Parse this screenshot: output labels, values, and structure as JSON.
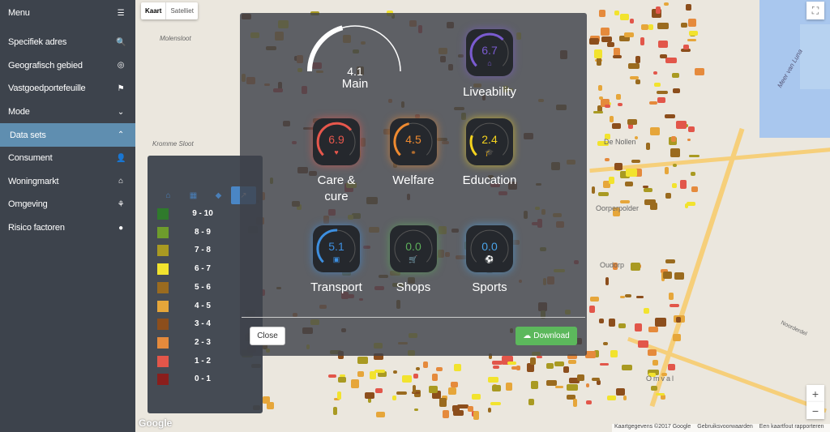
{
  "sidebar": {
    "title": "Menu",
    "items": [
      {
        "label": "Specifiek adres",
        "icon": "search-icon",
        "glyph": "🔍"
      },
      {
        "label": "Geografisch gebied",
        "icon": "target-icon",
        "glyph": "◎"
      },
      {
        "label": "Vastgoedportefeuille",
        "icon": "flag-icon",
        "glyph": "⚑"
      },
      {
        "label": "Mode",
        "icon": "chevron-circle-down-icon",
        "glyph": "⌄"
      },
      {
        "label": "Data sets",
        "icon": "chevron-circle-up-icon",
        "glyph": "⌃",
        "active": true
      },
      {
        "label": "Consument",
        "icon": "user-icon",
        "glyph": "👤"
      },
      {
        "label": "Woningmarkt",
        "icon": "home-icon",
        "glyph": "⌂"
      },
      {
        "label": "Omgeving",
        "icon": "tree-icon",
        "glyph": "⚘"
      },
      {
        "label": "Risico factoren",
        "icon": "bomb-icon",
        "glyph": "●"
      }
    ]
  },
  "map": {
    "type_buttons": [
      "Kaart",
      "Satelliet"
    ],
    "places": [
      "Molensloot",
      "Kromme Sloot",
      "De Nollen",
      "Oorperpolder",
      "Oudorp",
      "Omval",
      "Meer van Luna",
      "Noorderdel"
    ],
    "attribution": [
      "Kaartgegevens ©2017 Google",
      "Gebruiksvoorwaarden",
      "Een kaartfout rapporteren"
    ],
    "logo": "Google",
    "zoom_in": "+",
    "zoom_out": "−"
  },
  "legend": {
    "tabs": [
      "home-icon",
      "calendar-icon",
      "cube-icon",
      "chart-icon"
    ],
    "active_tab": 3,
    "items": [
      {
        "label": "9 - 10",
        "color": "#2f7a2c"
      },
      {
        "label": "8 - 9",
        "color": "#6e9c2c"
      },
      {
        "label": "7 - 8",
        "color": "#a99a22"
      },
      {
        "label": "6 - 7",
        "color": "#f2e32e"
      },
      {
        "label": "5 - 6",
        "color": "#9a6b1f"
      },
      {
        "label": "4 - 5",
        "color": "#e6a63a"
      },
      {
        "label": "3 - 4",
        "color": "#8c4e1c"
      },
      {
        "label": "2 - 3",
        "color": "#e58a3c"
      },
      {
        "label": "1 - 2",
        "color": "#e2564a"
      },
      {
        "label": "0 - 1",
        "color": "#8a1e1c"
      }
    ]
  },
  "modal": {
    "main": {
      "value": "4.1",
      "label": "Main"
    },
    "scores": [
      {
        "label": "Liveability",
        "value": "6.7",
        "color": "#7a5bd0",
        "icon": "home-icon",
        "glyph": "⌂"
      },
      {
        "label": "Care & cure",
        "value": "6.9",
        "color": "#e8574c",
        "icon": "heart-icon",
        "glyph": "♥"
      },
      {
        "label": "Welfare",
        "value": "4.5",
        "color": "#ee8a30",
        "icon": "handshake-icon",
        "glyph": "⚭"
      },
      {
        "label": "Education",
        "value": "2.4",
        "color": "#f3d21e",
        "icon": "graduation-cap-icon",
        "glyph": "🎓"
      },
      {
        "label": "Transport",
        "value": "5.1",
        "color": "#3d8fe0",
        "icon": "bus-icon",
        "glyph": "▣"
      },
      {
        "label": "Shops",
        "value": "0.0",
        "color": "#5cae5a",
        "icon": "cart-icon",
        "glyph": "🛒"
      },
      {
        "label": "Sports",
        "value": "0.0",
        "color": "#4aa3e8",
        "icon": "football-icon",
        "glyph": "⚽"
      }
    ],
    "close": "Close",
    "download": "Download"
  }
}
